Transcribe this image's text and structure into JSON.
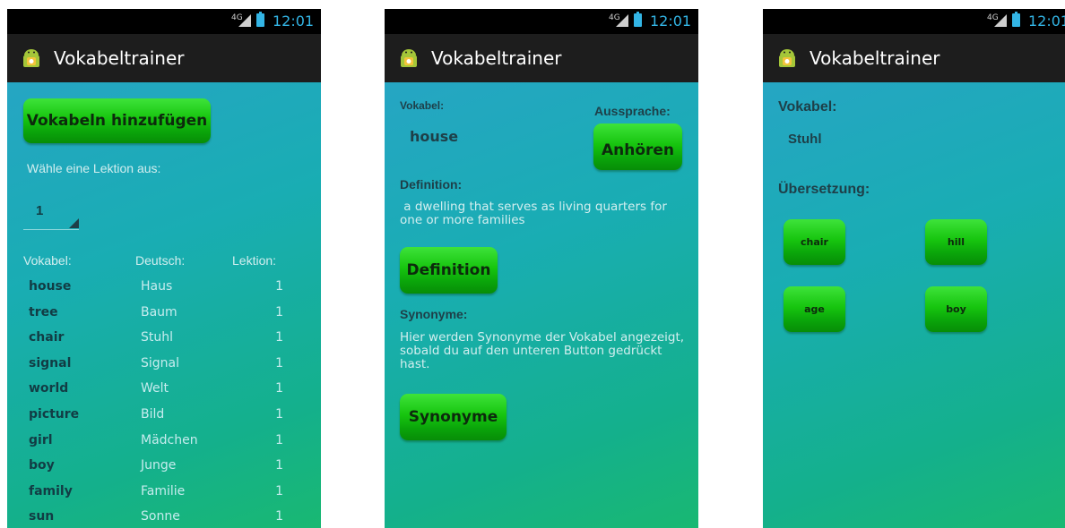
{
  "status": {
    "network": "4G",
    "time": "12:01"
  },
  "app": {
    "title": "Vokabeltrainer"
  },
  "screen1": {
    "add_button": "Vokabeln hinzufügen",
    "lesson_prompt": "Wähle eine Lektion aus:",
    "lesson_selected": "1",
    "headers": {
      "vokabel": "Vokabel:",
      "deutsch": "Deutsch:",
      "lektion": "Lektion:"
    },
    "rows": [
      {
        "word": "house",
        "german": "Haus",
        "lesson": "1"
      },
      {
        "word": "tree",
        "german": "Baum",
        "lesson": "1"
      },
      {
        "word": "chair",
        "german": "Stuhl",
        "lesson": "1"
      },
      {
        "word": "signal",
        "german": "Signal",
        "lesson": "1"
      },
      {
        "word": "world",
        "german": "Welt",
        "lesson": "1"
      },
      {
        "word": "picture",
        "german": "Bild",
        "lesson": "1"
      },
      {
        "word": "girl",
        "german": "Mädchen",
        "lesson": "1"
      },
      {
        "word": "boy",
        "german": "Junge",
        "lesson": "1"
      },
      {
        "word": "family",
        "german": "Familie",
        "lesson": "1"
      },
      {
        "word": "sun",
        "german": "Sonne",
        "lesson": "1"
      }
    ]
  },
  "screen2": {
    "vokabel_label": "Vokabel:",
    "word": "house",
    "pronunciation_label": "Aussprache:",
    "listen_button": "Anhören",
    "definition_label": "Definition:",
    "definition_text": "a dwelling that serves as living quarters for one or more families",
    "definition_button": "Definition",
    "synonyms_label": "Synonyme:",
    "synonyms_text": "Hier werden Synonyme der Vokabel angezeigt, sobald du auf den unteren Button gedrückt hast.",
    "synonyms_button": "Synonyme"
  },
  "screen3": {
    "vokabel_label": "Vokabel:",
    "word": "Stuhl",
    "translation_label": "Übersetzung:",
    "options": [
      "chair",
      "hill",
      "age",
      "boy"
    ]
  },
  "colors": {
    "button_green": "#17c50f",
    "status_blue": "#33b5e5",
    "actionbar": "#1d1d1d"
  },
  "icons": [
    "android-app-icon",
    "signal-icon",
    "battery-icon"
  ]
}
